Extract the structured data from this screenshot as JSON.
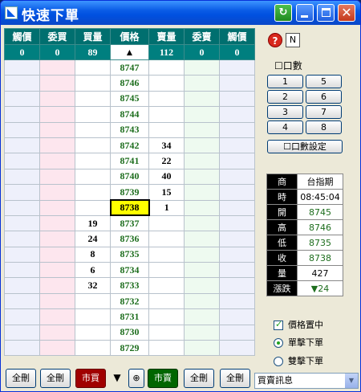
{
  "window": {
    "title": "快速下單",
    "close_glyph": "✕"
  },
  "grid": {
    "headers": [
      "觸價",
      "委買",
      "買量",
      "價格",
      "賣量",
      "委賣",
      "觸價"
    ],
    "summary": [
      "0",
      "0",
      "89",
      "▲",
      "112",
      "0",
      "0"
    ],
    "rows": [
      {
        "bq": "",
        "price": "8747",
        "sq": ""
      },
      {
        "bq": "",
        "price": "8746",
        "sq": ""
      },
      {
        "bq": "",
        "price": "8745",
        "sq": ""
      },
      {
        "bq": "",
        "price": "8744",
        "sq": ""
      },
      {
        "bq": "",
        "price": "8743",
        "sq": ""
      },
      {
        "bq": "",
        "price": "8742",
        "sq": "34"
      },
      {
        "bq": "",
        "price": "8741",
        "sq": "22"
      },
      {
        "bq": "",
        "price": "8740",
        "sq": "40"
      },
      {
        "bq": "",
        "price": "8739",
        "sq": "15"
      },
      {
        "bq": "",
        "price": "8738",
        "sq": "1",
        "current": true
      },
      {
        "bq": "19",
        "price": "8737",
        "sq": ""
      },
      {
        "bq": "24",
        "price": "8736",
        "sq": ""
      },
      {
        "bq": "8",
        "price": "8735",
        "sq": ""
      },
      {
        "bq": "6",
        "price": "8734",
        "sq": ""
      },
      {
        "bq": "32",
        "price": "8733",
        "sq": ""
      },
      {
        "bq": "",
        "price": "8732",
        "sq": ""
      },
      {
        "bq": "",
        "price": "8731",
        "sq": ""
      },
      {
        "bq": "",
        "price": "8730",
        "sq": ""
      },
      {
        "bq": "",
        "price": "8729",
        "sq": ""
      }
    ]
  },
  "panel": {
    "help_label": "?",
    "n_label": "N",
    "qty_label": "口數",
    "qty_buttons": [
      "1",
      "5",
      "2",
      "6",
      "3",
      "7",
      "4",
      "8"
    ],
    "qty_settings_label": "口數設定",
    "info": [
      {
        "k": "商",
        "v": "台指期"
      },
      {
        "k": "時",
        "v": "08:45:04"
      },
      {
        "k": "開",
        "v": "8745",
        "green": true
      },
      {
        "k": "高",
        "v": "8746",
        "green": true
      },
      {
        "k": "低",
        "v": "8735",
        "green": true
      },
      {
        "k": "收",
        "v": "8738",
        "green": true
      },
      {
        "k": "量",
        "v": "427"
      },
      {
        "k": "漲跌",
        "v": "▼24",
        "green": true
      }
    ],
    "center_price_label": "價格置中",
    "single_click_label": "單擊下單",
    "double_click_label": "雙擊下單"
  },
  "bottom": {
    "cancel_all_1": "全刪",
    "cancel_all_2": "全刪",
    "market_buy": "市買",
    "down_arrow": "▼",
    "plus": "⊕",
    "market_sell": "市賣",
    "cancel_all_3": "全刪",
    "cancel_all_4": "全刪",
    "dropdown_value": "買賣訊息"
  }
}
